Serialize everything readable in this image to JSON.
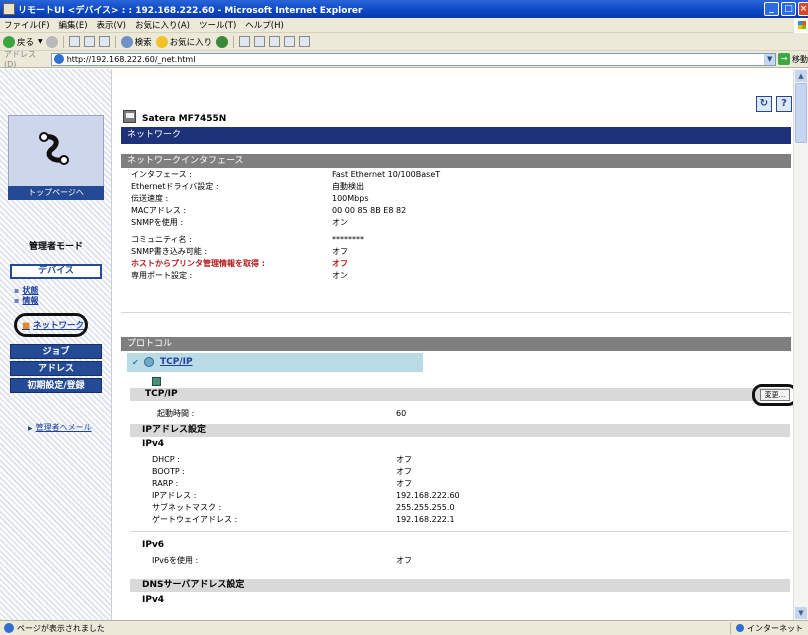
{
  "window": {
    "title": "リモートUI <デバイス> : : 192.168.222.60 - Microsoft Internet Explorer",
    "buttons": [
      "minimize",
      "maximize",
      "close"
    ]
  },
  "menu": [
    "ファイル(F)",
    "編集(E)",
    "表示(V)",
    "お気に入り(A)",
    "ツール(T)",
    "ヘルプ(H)"
  ],
  "toolbar": {
    "back_label": "戻る",
    "search_label": "検索",
    "favorites_label": "お気に入り"
  },
  "address": {
    "label": "アドレス(D)",
    "url": "http://192.168.222.60/_net.html",
    "go_label": "移動"
  },
  "sidebar": {
    "top_page": "トップページへ",
    "admin_mode": "管理者モード",
    "device": "デバイス",
    "status": "状態",
    "info": "情報",
    "network": "ネットワーク",
    "job": "ジョブ",
    "address": "アドレス",
    "settings": "初期設定/登録",
    "admin_mail": "管理者へメール"
  },
  "header": {
    "model": "Satera MF7455N",
    "refresh_icon": "refresh-icon",
    "help_icon": "help-icon"
  },
  "page": {
    "title": "ネットワーク",
    "iface_section": "ネットワークインタフェース",
    "protocol_section": "プロトコル"
  },
  "iface": [
    {
      "k": "インタフェース :",
      "v": "Fast Ethernet 10/100BaseT"
    },
    {
      "k": "Ethernetドライバ設定 :",
      "v": "自動検出"
    },
    {
      "k": "伝送速度 :",
      "v": "100Mbps"
    },
    {
      "k": "MACアドレス :",
      "v": "00 00 85 8B E8 82"
    },
    {
      "k": "SNMPを使用 :",
      "v": "オン"
    },
    {
      "k": "コミュニティ名 :",
      "v": "********"
    },
    {
      "k": "SNMP書き込み可能 :",
      "v": "オフ"
    },
    {
      "k": "ホストからプリンタ管理情報を取得 :",
      "v": "オフ"
    },
    {
      "k": "専用ポート設定 :",
      "v": "オン"
    }
  ],
  "protocol": {
    "tcpip_link": "TCP/IP",
    "tcp_header": "TCP/IP",
    "change_button": "変更...",
    "startup_label": "起動時間 :",
    "startup_value": "60",
    "ip_addr_header": "IPアドレス設定",
    "ipv4_label": "IPv4",
    "ipv4": [
      {
        "k": "DHCP :",
        "v": "オフ"
      },
      {
        "k": "BOOTP :",
        "v": "オフ"
      },
      {
        "k": "RARP :",
        "v": "オフ"
      },
      {
        "k": "IPアドレス :",
        "v": "192.168.222.60"
      },
      {
        "k": "サブネットマスク :",
        "v": "255.255.255.0"
      },
      {
        "k": "ゲートウェイアドレス :",
        "v": "192.168.222.1"
      }
    ],
    "ipv6_label": "IPv6",
    "ipv6_use_label": "IPv6を使用 :",
    "ipv6_use_value": "オフ",
    "dns_header": "DNSサーバアドレス設定",
    "dns_ipv4_label": "IPv4"
  },
  "status": {
    "text": "ページが表示されました",
    "zone": "インターネット"
  }
}
